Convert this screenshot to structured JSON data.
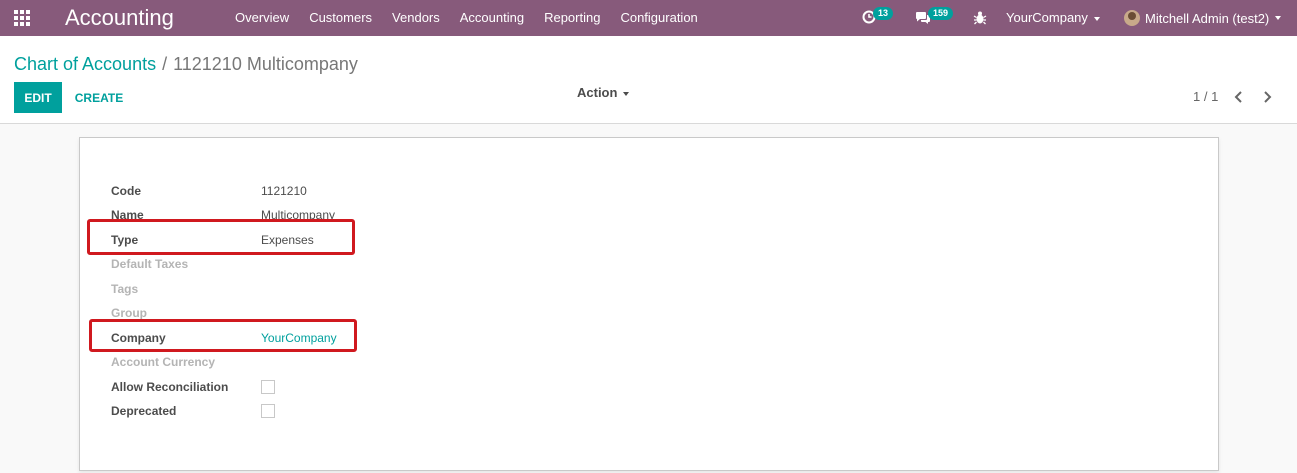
{
  "navbar": {
    "app_title": "Accounting",
    "menu": [
      "Overview",
      "Customers",
      "Vendors",
      "Accounting",
      "Reporting",
      "Configuration"
    ],
    "activity_count": "13",
    "message_count": "159",
    "company": "YourCompany",
    "user": "Mitchell Admin (test2)",
    "colors": {
      "brand": "#875a7b",
      "accent": "#00a09d"
    }
  },
  "control_panel": {
    "breadcrumb": {
      "parent": "Chart of Accounts",
      "separator": "/",
      "current": "1121210 Multicompany"
    },
    "edit_label": "EDIT",
    "create_label": "CREATE",
    "action_label": "Action",
    "pager": "1 / 1"
  },
  "form": {
    "fields": [
      {
        "label": "Code",
        "value": "1121210"
      },
      {
        "label": "Name",
        "value": "Multicompany"
      },
      {
        "label": "Type",
        "value": "Expenses"
      },
      {
        "label": "Default Taxes",
        "value": ""
      },
      {
        "label": "Tags",
        "value": ""
      },
      {
        "label": "Group",
        "value": ""
      },
      {
        "label": "Company",
        "value": "YourCompany"
      },
      {
        "label": "Account Currency",
        "value": ""
      },
      {
        "label": "Allow Reconciliation",
        "checked": false
      },
      {
        "label": "Deprecated",
        "checked": false
      }
    ]
  },
  "highlight_color": "#d0191f"
}
